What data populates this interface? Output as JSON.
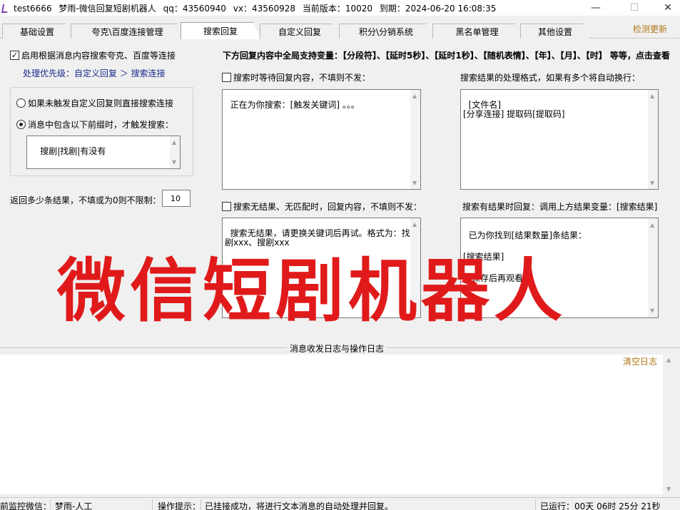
{
  "window": {
    "app_name": "test6666",
    "title": "梦雨-微信回复短剧机器人",
    "qq": "qq：43560940",
    "vx": "vx：43560928",
    "version": "当前版本：10020",
    "expiry": "到期：2024-06-20 16:08:35",
    "min_icon": "—",
    "max_icon": "☐",
    "close_icon": "✕"
  },
  "tabs": [
    {
      "label": "基础设置"
    },
    {
      "label": "夸克\\百度连接管理"
    },
    {
      "label": "搜索回复",
      "active": true
    },
    {
      "label": "自定义回复"
    },
    {
      "label": "积分\\分销系统"
    },
    {
      "label": "黑名单管理"
    },
    {
      "label": "其他设置"
    }
  ],
  "check_update": "检测更新",
  "left": {
    "enable_label": "启用根据消息内容搜索夸克、百度等连接",
    "enable_checked": "✓",
    "priority": "处理优先级：自定义回复 ＞ 搜索连接",
    "option1": "如果未触发自定义回复则直接搜索连接",
    "option2": "消息中包含以下前缀时，才触发搜索：",
    "prefixes": "搜剧|找剧|有没有",
    "return_label": "返回多少条结果，不填或为0则不限制：",
    "return_value": "10"
  },
  "right": {
    "vars_header": "下方回复内容中全局支持变量：【分段符】、【延时5秒】、【延时1秒】、【随机表情】、【年】、【月】、【时】 等等，点击查看",
    "waiting_label": "搜索时等待回复内容，不填则不发：",
    "waiting_text": "正在为你搜索：[触发关键词] 。。。",
    "format_label": "搜索结果的处理格式，如果有多个将自动换行：",
    "format_text": "[文件名]\n[分享连接] 提取码[提取码]",
    "noresult_label": "搜索无结果、无匹配时，回复内容，不填则不发：",
    "noresult_text": "搜索无结果，请更换关键词后再试。格式为：找剧xxx、搜剧xxx",
    "hasresult_label": "搜索有结果时回复：调用上方结果变量：[搜索结果]",
    "hasresult_text": "已为你找到[结果数量]条结果：\n\n[搜索结果]\n\n请保存后再观看。"
  },
  "watermark": "微信短剧机器人",
  "log": {
    "title": "消息收发日志与操作日志",
    "clear": "清空日志"
  },
  "status": {
    "monitor_label": "前监控微信：",
    "monitor_value": "梦雨-人工",
    "hint_label": "操作提示：",
    "hint_value": "已挂接成功，将进行文本消息的自动处理并回复。",
    "runtime": "已运行：00天 06时 25分 21秒"
  }
}
